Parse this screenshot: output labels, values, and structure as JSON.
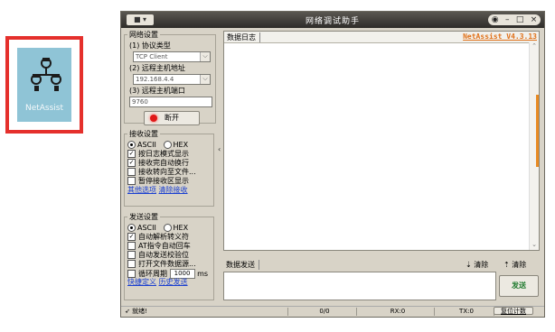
{
  "desktop_icon": {
    "label": "NetAssist"
  },
  "window": {
    "title": "网络调试助手",
    "app_icon": "■ ▾",
    "controls": [
      "◉",
      "–",
      "□",
      "×"
    ]
  },
  "net_settings": {
    "legend": "网络设置",
    "protocol_label": "(1) 协议类型",
    "protocol_value": "TCP Client",
    "host_label": "(2) 远程主机地址",
    "host_value": "192.168.4.4",
    "port_label": "(3) 远程主机端口",
    "port_value": "9760",
    "connect_label": "断开"
  },
  "recv_settings": {
    "legend": "接收设置",
    "ascii": "ASCII",
    "hex": "HEX",
    "options": [
      {
        "label": "按日志模式显示",
        "checked": true
      },
      {
        "label": "接收完自动换行",
        "checked": true
      },
      {
        "label": "接收转向至文件...",
        "checked": false
      },
      {
        "label": "暂停接收区显示",
        "checked": false
      }
    ],
    "link_more": "其他选项",
    "link_clear": "清除接收"
  },
  "send_settings": {
    "legend": "发送设置",
    "ascii": "ASCII",
    "hex": "HEX",
    "options": [
      {
        "label": "自动解析转义符",
        "checked": true
      },
      {
        "label": "AT指令自动回车",
        "checked": false
      },
      {
        "label": "自动发送校验位",
        "checked": false
      },
      {
        "label": "打开文件数据源...",
        "checked": false
      }
    ],
    "loop_label": "循环周期",
    "loop_value": "1000",
    "loop_unit": "ms",
    "link_shortcut": "快捷定义",
    "link_history": "历史发送"
  },
  "log": {
    "tab": "数据日志",
    "version": "NetAssist V4.3.13"
  },
  "send": {
    "tab": "数据发送",
    "clear1": "清除",
    "clear2": "清除",
    "send_button": "发送"
  },
  "status": {
    "ready": "就绪!",
    "count": "0/0",
    "rx": "RX:0",
    "tx": "TX:0",
    "reset": "复位计数"
  }
}
